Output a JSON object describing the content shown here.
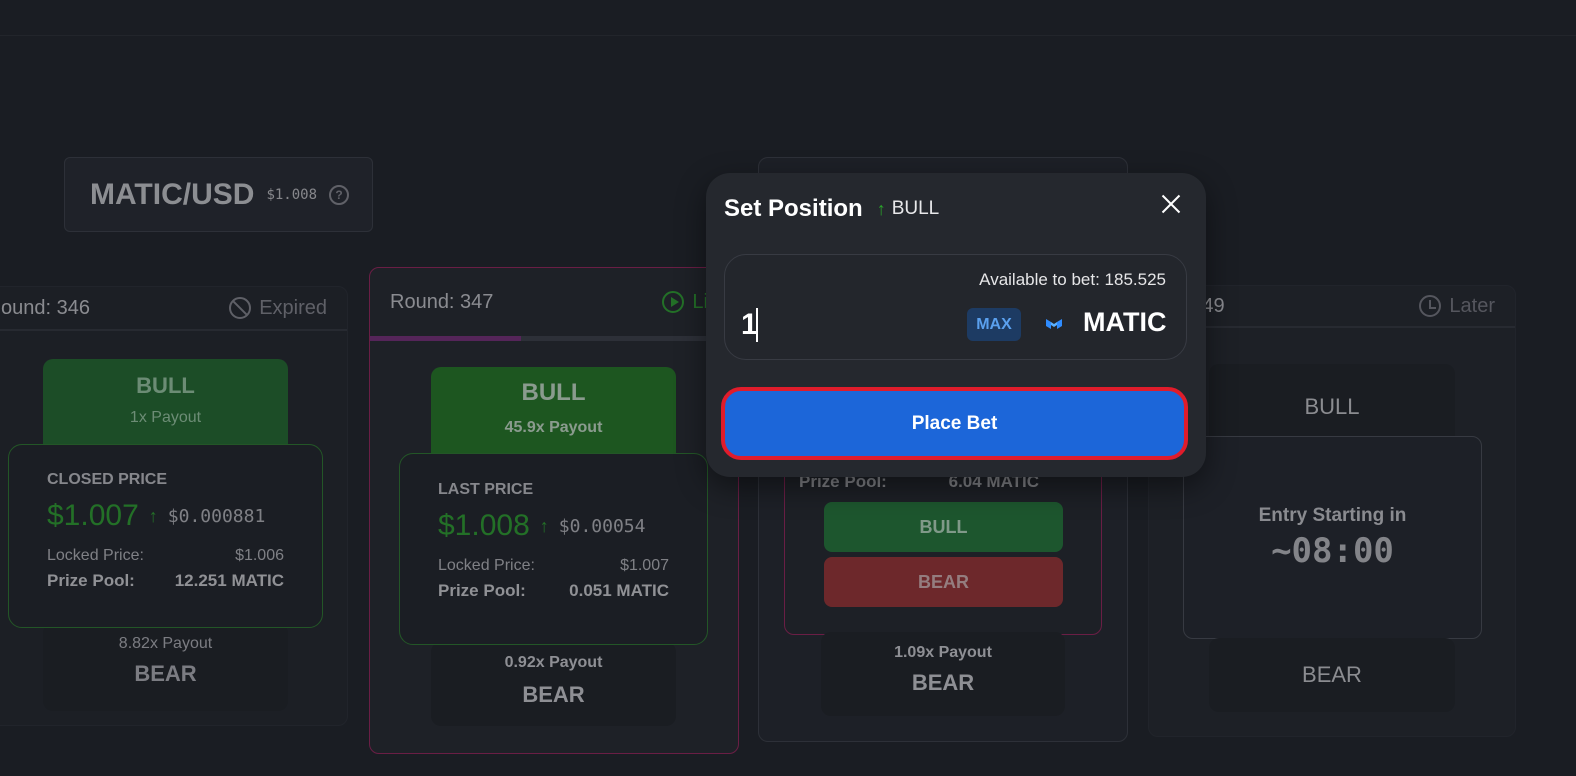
{
  "header": {
    "pair": "MATIC/USD",
    "price": "$1.008",
    "help": "?"
  },
  "round346": {
    "title": "ound: 346",
    "status": "Expired",
    "bull": "BULL",
    "bull_payout": "1x Payout",
    "price_title": "CLOSED PRICE",
    "price": "$1.007",
    "change": "$0.000881",
    "locked_label": "Locked Price:",
    "locked_value": "$1.006",
    "pool_label": "Prize Pool:",
    "pool_value": "12.251 MATIC",
    "bear_payout": "8.82x Payout",
    "bear": "BEAR"
  },
  "round347": {
    "title": "Round: 347",
    "status": "Liv",
    "bull": "BULL",
    "bull_payout": "45.9x Payout",
    "price_title": "LAST PRICE",
    "price": "$1.008",
    "change": "$0.00054",
    "locked_label": "Locked Price:",
    "locked_value": "$1.007",
    "pool_label": "Prize Pool:",
    "pool_value": "0.051 MATIC",
    "bear_payout": "0.92x Payout",
    "bear": "BEAR",
    "progress": 0.41
  },
  "round348": {
    "pool_label": "Prize Pool:",
    "pool_value": "6.04 MATIC",
    "bull_button": "BULL",
    "bear_button": "BEAR",
    "bear_payout": "1.09x Payout",
    "bear": "BEAR"
  },
  "round349": {
    "title": "d: 349",
    "status": "Later",
    "bull": "BULL",
    "entry_label": "Entry Starting in",
    "entry_time": "~08:00",
    "bear": "BEAR"
  },
  "modal": {
    "title": "Set Position",
    "direction": "BULL",
    "available": "Available to bet: 185.525",
    "amount": "1",
    "max_label": "MAX",
    "token": "MATIC",
    "place_bet": "Place Bet"
  },
  "colors": {
    "accent": "#1c66d9",
    "bull": "#1f7a36",
    "bear": "#a03030",
    "highlight": "#e01c2b"
  }
}
